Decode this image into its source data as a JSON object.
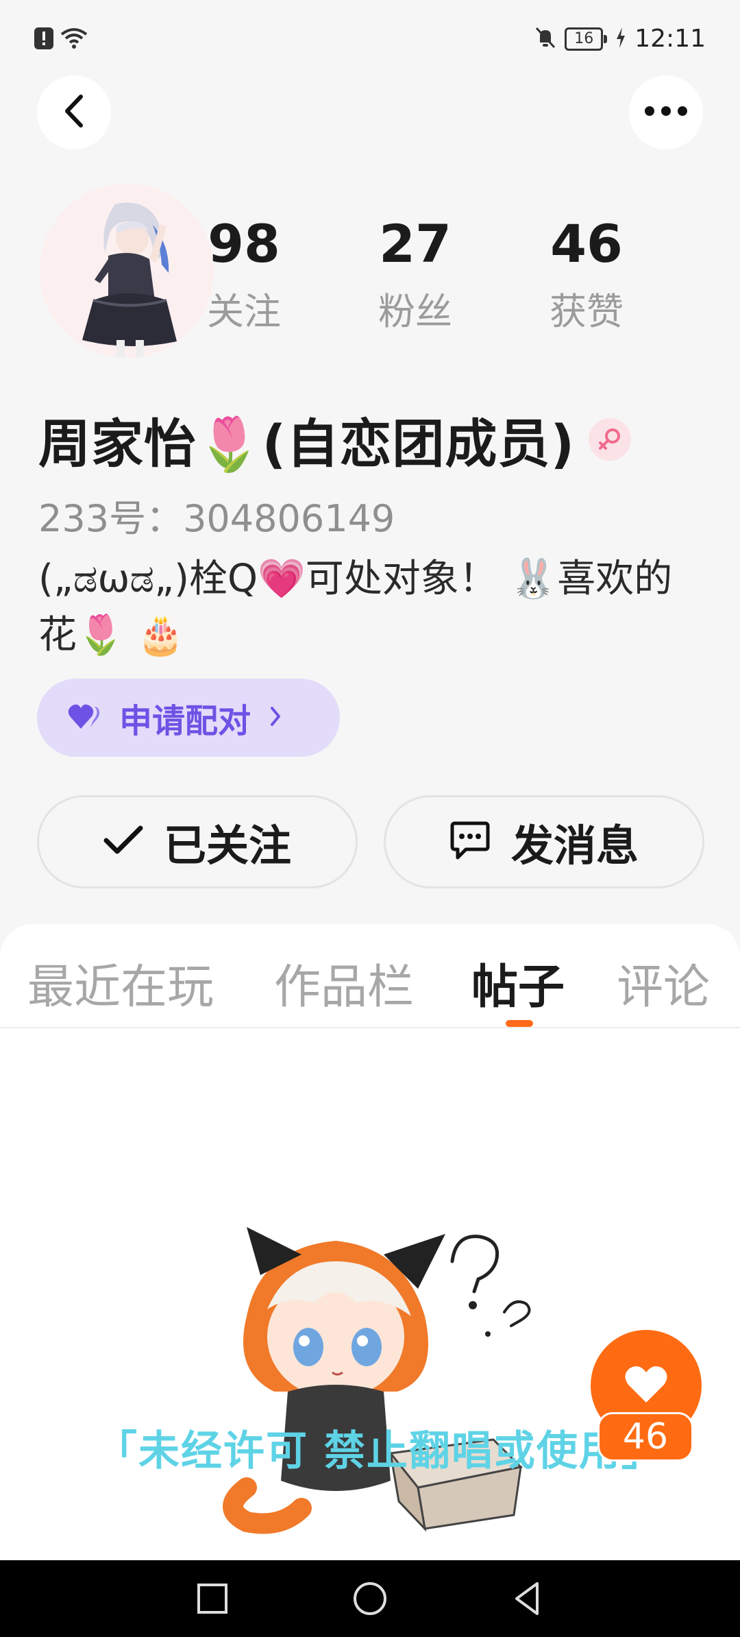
{
  "status_bar": {
    "time": "12:11",
    "battery": "16",
    "icons": [
      "alert-icon",
      "wifi-icon",
      "mute-icon",
      "battery-icon",
      "charging-icon"
    ]
  },
  "header": {
    "back_icon": "chevron-left-icon",
    "more_icon": "more-dots-icon"
  },
  "stats": [
    {
      "value": "98",
      "label": "关注"
    },
    {
      "value": "27",
      "label": "粉丝"
    },
    {
      "value": "46",
      "label": "获赞"
    }
  ],
  "profile": {
    "name": "周家怡🌷(自恋团成员)",
    "uid": "233号：304806149",
    "bio_line1": "(„ಡωಡ„)栓Q💗可处对象！ 🐰喜欢的",
    "bio_line2": "花🌷 🎂"
  },
  "pair_button": {
    "label": "申请配对",
    "icon": "double-heart-icon"
  },
  "actions": {
    "follow_label": "已关注",
    "message_label": "发消息"
  },
  "tabs": [
    {
      "label": "最近在玩",
      "active": false
    },
    {
      "label": "作品栏",
      "active": false
    },
    {
      "label": "帖子",
      "active": true
    },
    {
      "label": "评论",
      "active": false
    }
  ],
  "watermark": "「未经许可 禁止翻唱或使用」",
  "like": {
    "count": "46"
  },
  "colors": {
    "accent": "#ff6b12",
    "pair_bg": "#e2dcfa",
    "pair_text": "#6d53e5",
    "watermark": "#5fd3e6"
  }
}
